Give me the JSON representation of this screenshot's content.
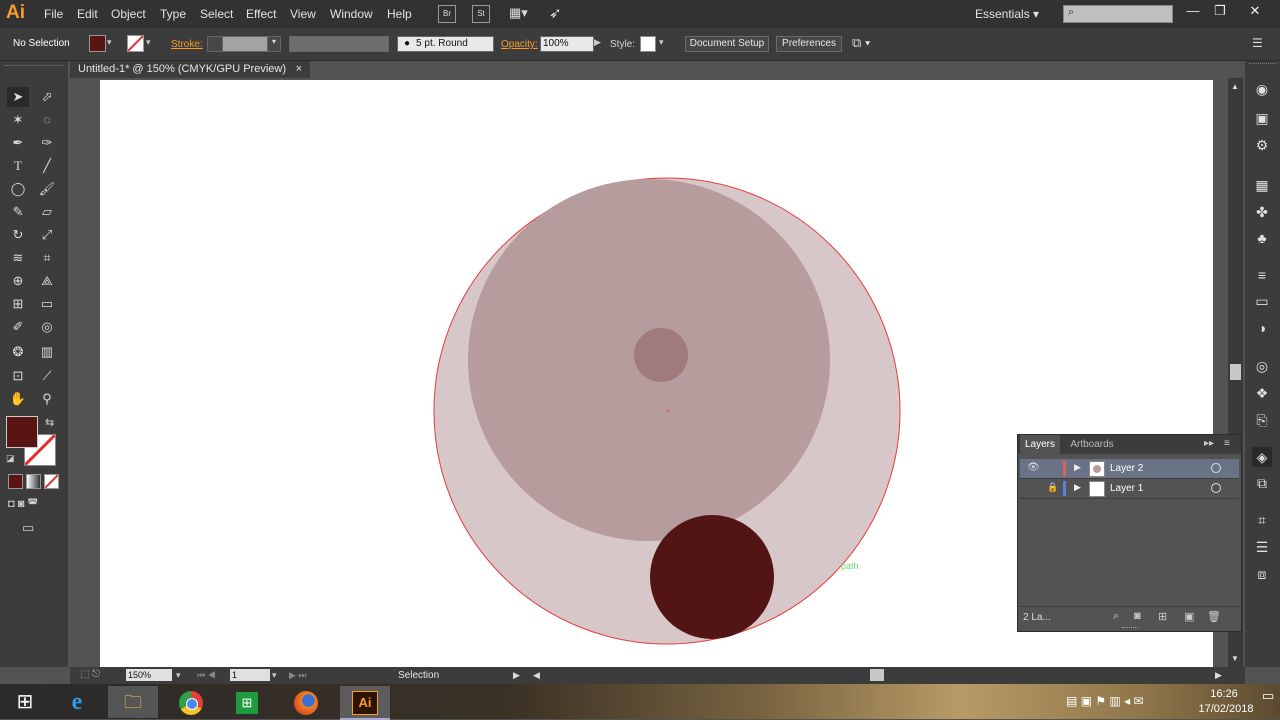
{
  "app": {
    "logo": "Ai"
  },
  "menu": [
    "File",
    "Edit",
    "Object",
    "Type",
    "Select",
    "Effect",
    "View",
    "Window",
    "Help"
  ],
  "menu_buttons": [
    "Br",
    "St"
  ],
  "workspace": "Essentials",
  "control": {
    "selection": "No Selection",
    "stroke_label": "Stroke:",
    "brush": "5 pt. Round",
    "opacity_label": "Opacity:",
    "opacity_value": "100%",
    "style_label": "Style:",
    "doc_setup": "Document Setup",
    "preferences": "Preferences"
  },
  "document_tab": {
    "title": "Untitled-1* @ 150% (CMYK/GPU Preview)",
    "close": "×"
  },
  "colors": {
    "fill": "#5a1414",
    "accent": "#f79b2e",
    "big_circle": "#d8c7c8",
    "mid_circle": "#b69c9d",
    "small_circle": "#a07b7c",
    "dark_circle": "#521414",
    "selection": "#e63c3c"
  },
  "canvas": {
    "hint": "path"
  },
  "layers_panel": {
    "tabs": [
      "Layers",
      "Artboards"
    ],
    "rows": [
      {
        "name": "Layer 2",
        "color": "#e06060",
        "selected": true
      },
      {
        "name": "Layer 1",
        "color": "#5a7fe0",
        "selected": false
      }
    ],
    "count": "2 La..."
  },
  "status": {
    "zoom": "150%",
    "artboard": "1",
    "tool": "Selection"
  },
  "taskbar": {
    "time": "16:26",
    "date": "17/02/2018"
  }
}
